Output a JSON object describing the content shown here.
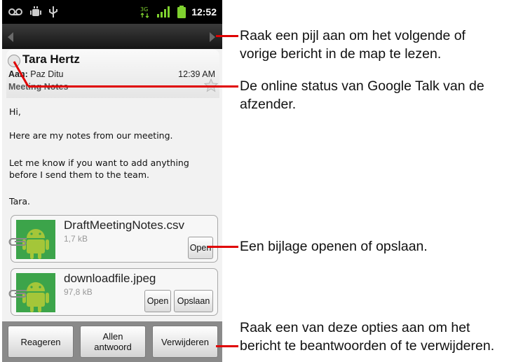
{
  "status_bar": {
    "time": "12:52",
    "network_badge": "3G"
  },
  "message": {
    "sender": "Tara Hertz",
    "to_label": "Aan:",
    "to_value": "Paz Ditu",
    "time": "12:39 AM",
    "subject": "Meeting Notes",
    "body": [
      "Hi,",
      "Here are my notes from our meeting.",
      "Let me know if you want to add anything",
      "before I send them to the team.",
      "Tara."
    ]
  },
  "attachments": [
    {
      "name": "DraftMeetingNotes.csv",
      "size": "1,7 kB",
      "open_label": "Open"
    },
    {
      "name": "downloadfile.jpeg",
      "size": "97,8 kB",
      "open_label": "Open",
      "save_label": "Opslaan"
    }
  ],
  "actions": {
    "reply": "Reageren",
    "reply_all_line1": "Allen",
    "reply_all_line2": "antwoord",
    "delete": "Verwijderen"
  },
  "callouts": {
    "nav_line1": "Raak een pijl aan om het volgende of",
    "nav_line2": "vorige bericht in de map te lezen.",
    "status_line1": "De online status van Google Talk van de",
    "status_line2": "afzender.",
    "attach_line1": "Een bijlage openen of opslaan.",
    "actions_line1": "Raak een van deze opties aan om het",
    "actions_line2": "bericht te beantwoorden of te verwijderen."
  },
  "colors": {
    "leader": "#e00000",
    "status_bar": "#000000",
    "battery": "#7fd12f"
  },
  "icons": [
    "voicemail-icon",
    "android-debug-icon",
    "usb-icon",
    "network-3g-icon",
    "signal-icon",
    "battery-icon",
    "left-arrow-icon",
    "right-arrow-icon",
    "presence-icon",
    "star-icon",
    "paperclip-icon",
    "android-thumbnail-icon"
  ]
}
